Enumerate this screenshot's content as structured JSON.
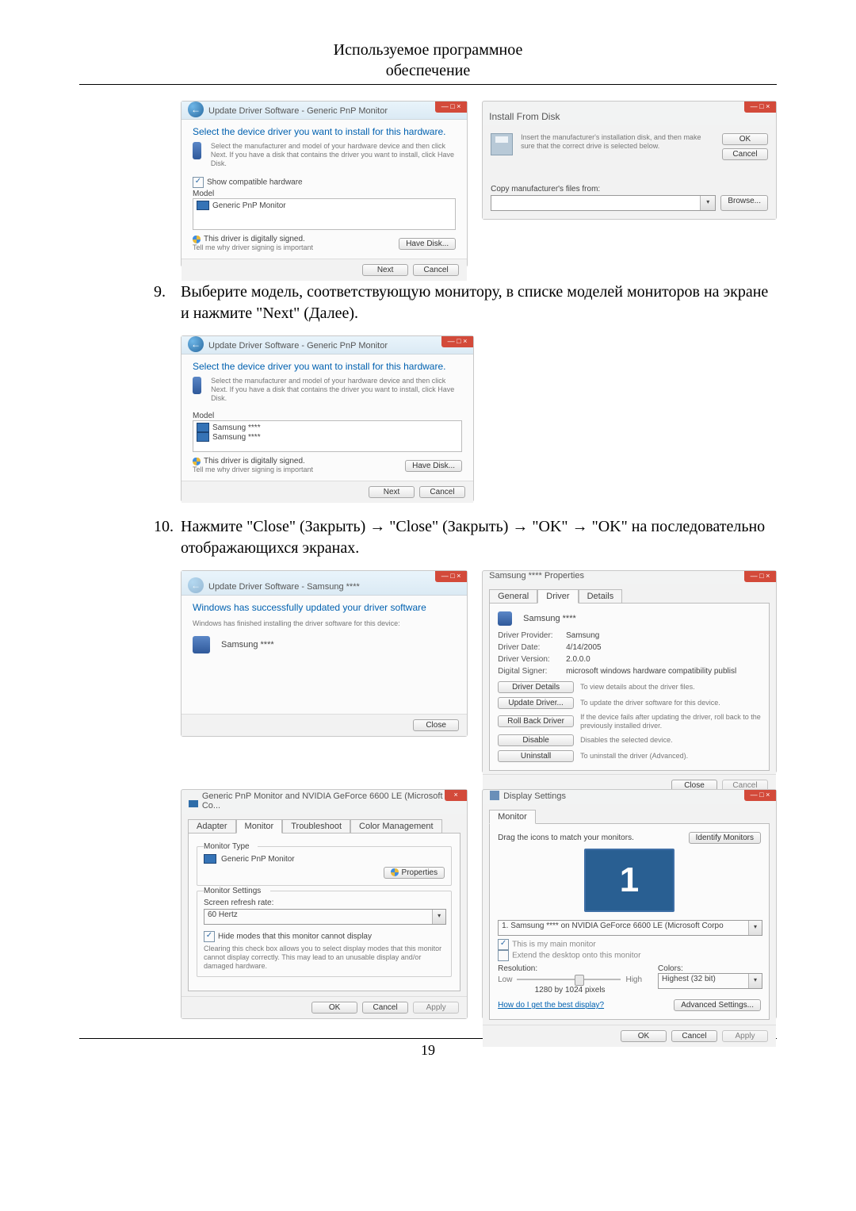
{
  "title_line1": "Используемое программное",
  "title_line2": "обеспечение",
  "page_number": "19",
  "steps": {
    "s9": {
      "num": "9.",
      "txt": "Выберите модель, соответствующую монитору, в списке моделей мониторов на экране и нажмите \"Next\" (Далее)."
    },
    "s10": {
      "num": "10.",
      "txt": "Нажмите \"Close\" (Закрыть) → \"Close\" (Закрыть) → \"OK\" → \"OK\" на последовательно отображающихся экранах."
    }
  },
  "driver_win": {
    "title": "Update Driver Software - Generic PnP Monitor",
    "heading": "Select the device driver you want to install for this hardware.",
    "note": "Select the manufacturer and model of your hardware device and then click Next. If you have a disk that contains the driver you want to install, click Have Disk.",
    "show_compat": "Show compatible hardware",
    "model": "Model",
    "list_item": "Generic PnP Monitor",
    "signed": "This driver is digitally signed.",
    "signed_link": "Tell me why driver signing is important",
    "have_disk": "Have Disk...",
    "next": "Next",
    "cancel": "Cancel"
  },
  "ifd": {
    "title": "Install From Disk",
    "msg": "Insert the manufacturer's installation disk, and then make sure that the correct drive is selected below.",
    "ok": "OK",
    "cancel": "Cancel",
    "copy": "Copy manufacturer's files from:",
    "browse": "Browse..."
  },
  "driver_win2": {
    "title": "Update Driver Software - Generic PnP Monitor",
    "model": "Model",
    "item": "Samsung ****",
    "have_disk": "Have Disk...",
    "next": "Next",
    "cancel": "Cancel"
  },
  "finish": {
    "title": "Update Driver Software - Samsung ****",
    "done": "Windows has successfully updated your driver software",
    "sub": "Windows has finished installing the driver software for this device:",
    "dev": "Samsung ****",
    "close": "Close"
  },
  "props": {
    "title": "Samsung **** Properties",
    "tab_general": "General",
    "tab_driver": "Driver",
    "tab_details": "Details",
    "dev": "Samsung ****",
    "provider_k": "Driver Provider:",
    "provider_v": "Samsung",
    "date_k": "Driver Date:",
    "date_v": "4/14/2005",
    "ver_k": "Driver Version:",
    "ver_v": "2.0.0.0",
    "sig_k": "Digital Signer:",
    "sig_v": "microsoft windows hardware compatibility publisl",
    "b_details": "Driver Details",
    "t_details": "To view details about the driver files.",
    "b_update": "Update Driver...",
    "t_update": "To update the driver software for this device.",
    "b_roll": "Roll Back Driver",
    "t_roll": "If the device fails after updating the driver, roll back to the previously installed driver.",
    "b_disable": "Disable",
    "t_disable": "Disables the selected device.",
    "b_uninstall": "Uninstall",
    "t_uninstall": "To uninstall the driver (Advanced).",
    "close": "Close",
    "cancel": "Cancel"
  },
  "mon_panel": {
    "title": "Generic PnP Monitor and NVIDIA GeForce 6600 LE (Microsoft Co...",
    "tab_adapter": "Adapter",
    "tab_monitor": "Monitor",
    "tab_trouble": "Troubleshoot",
    "tab_color": "Color Management",
    "grp_type": "Monitor Type",
    "dev": "Generic PnP Monitor",
    "b_props": "Properties",
    "grp_settings": "Monitor Settings",
    "refresh_lbl": "Screen refresh rate:",
    "refresh": "60 Hertz",
    "hide": "Hide modes that this monitor cannot display",
    "warn": "Clearing this check box allows you to select display modes that this monitor cannot display correctly. This may lead to an unusable display and/or damaged hardware.",
    "ok": "OK",
    "cancel": "Cancel",
    "apply": "Apply"
  },
  "disp": {
    "title": "Display Settings",
    "tab": "Monitor",
    "drag": "Drag the icons to match your monitors.",
    "identify": "Identify Monitors",
    "mon_num": "1",
    "desc": "1. Samsung **** on NVIDIA GeForce 6600 LE (Microsoft Corpo",
    "main": "This is my main monitor",
    "extend": "Extend the desktop onto this monitor",
    "res_group": "Resolution:",
    "low": "Low",
    "high": "High",
    "res": "1280 by 1024 pixels",
    "col_group": "Colors:",
    "col": "Highest (32 bit)",
    "best": "How do I get the best display?",
    "adv": "Advanced Settings...",
    "ok": "OK",
    "cancel": "Cancel",
    "apply": "Apply"
  }
}
